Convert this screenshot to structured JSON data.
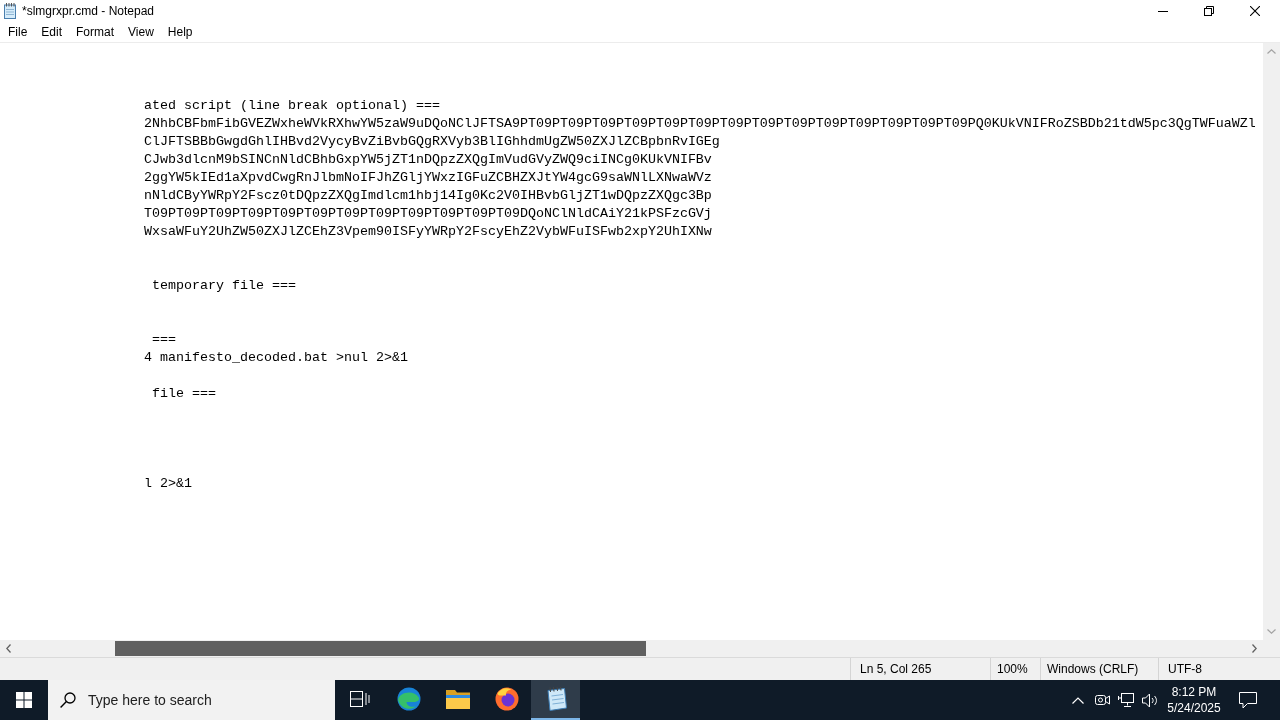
{
  "window": {
    "title": "*slmgrxpr.cmd - Notepad"
  },
  "menu": [
    "File",
    "Edit",
    "Format",
    "View",
    "Help"
  ],
  "editor": {
    "lines": [
      {
        "kind": "blank"
      },
      {
        "kind": "blank"
      },
      {
        "kind": "blank"
      },
      {
        "kind": "text",
        "text": "ated script (line break optional) ==="
      },
      {
        "kind": "text",
        "text": "2NhbCBFbmFibGVEZWxheWVkRXhwYW5zaW9uDQoNClJFTSA9PT09PT09PT09PT09PT09PT09PT09PT09PT09PT09PT09PT09PT09PT09PQ0KUkVNIFRoZSBDb21tdW5pc3QgTWFuaWZl"
      },
      {
        "kind": "text",
        "text": "ClJFTSBBbGwgdGhlIHBvd2VycyBvZiBvbGQgRXVyb3BlIGhhdmUgZW50ZXJlZCBpbnRvIGEg"
      },
      {
        "kind": "text",
        "text": "CJwb3dlcnM9bSINCnNldCBhbGxpYW5jZT1nDQpzZXQgImVudGVyZWQ9ciINCg0KUkVNIFBv"
      },
      {
        "kind": "text",
        "text": "2ggYW5kIEd1aXpvdCwgRnJlbmNoIFJhZGljYWxzIGFuZCBHZXJtYW4gcG9saWNlLXNwaWVz"
      },
      {
        "kind": "text",
        "text": "nNldCByYWRpY2Fscz0tDQpzZXQgImdlcm1hbj14Ig0Kc2V0IHBvbGljZT1wDQpzZXQgc3Bp"
      },
      {
        "kind": "text",
        "text": "T09PT09PT09PT09PT09PT09PT09PT09PT09PT09PT09PT09DQoNClNldCAiY21kPSFzcGVj"
      },
      {
        "kind": "text",
        "text": "WxsaWFuY2UhZW50ZXJlZCEhZ3Vpem90ISFyYWRpY2FscyEhZ2VybWFuISFwb2xpY2UhIXNw"
      },
      {
        "kind": "blank"
      },
      {
        "kind": "blank"
      },
      {
        "kind": "text",
        "text": " temporary file ==="
      },
      {
        "kind": "blank"
      },
      {
        "kind": "blank"
      },
      {
        "kind": "text",
        "text": " ==="
      },
      {
        "kind": "text",
        "text": "4 manifesto_decoded.bat >nul 2>&1"
      },
      {
        "kind": "blank"
      },
      {
        "kind": "text",
        "text": " file ==="
      },
      {
        "kind": "blank"
      },
      {
        "kind": "blank"
      },
      {
        "kind": "blank"
      },
      {
        "kind": "blank"
      },
      {
        "kind": "text",
        "text": "l 2>&1"
      }
    ]
  },
  "status_bar": {
    "position": "Ln 5, Col 265",
    "zoom": "100%",
    "line_ending": "Windows (CRLF)",
    "encoding": "UTF-8"
  },
  "taskbar": {
    "search": {
      "placeholder": "Type here to search"
    },
    "apps": [
      {
        "kind": "task_view",
        "selected": false
      },
      {
        "kind": "edge",
        "selected": false
      },
      {
        "kind": "file_explorer",
        "selected": false
      },
      {
        "kind": "firefox",
        "selected": false
      },
      {
        "kind": "notepad",
        "selected": true
      }
    ],
    "clock": {
      "time": "8:12 PM",
      "date": "5/24/2025"
    }
  }
}
